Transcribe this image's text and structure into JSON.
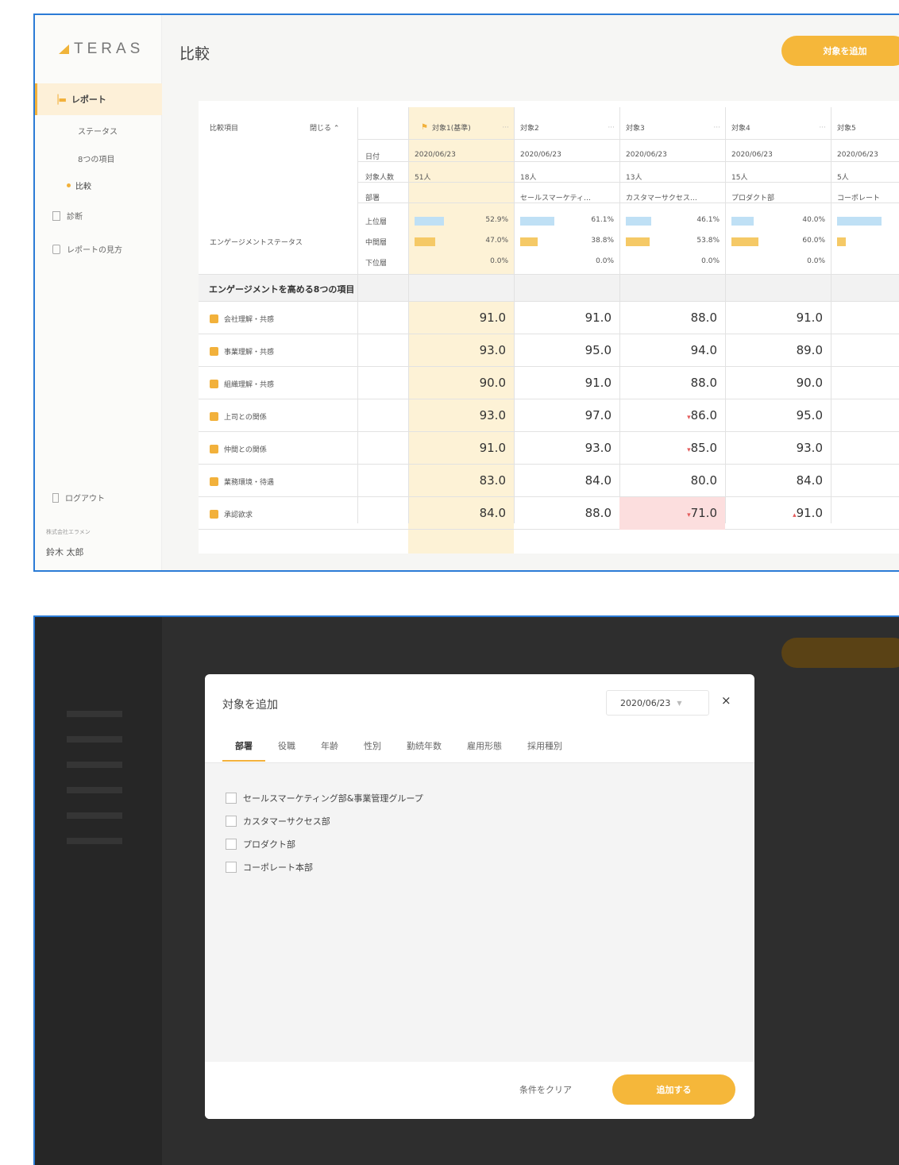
{
  "app": {
    "logo": "TERAS",
    "page_title": "比較",
    "add_target_label": "対象を追加"
  },
  "sidebar": {
    "report_label": "レポート",
    "sub_items": [
      "ステータス",
      "8つの項目",
      "比較"
    ],
    "diagnosis_label": "診断",
    "guide_label": "レポートの見方",
    "logout_label": "ログアウト",
    "company": "株式会社エラメン",
    "user": "鈴木 太郎"
  },
  "table": {
    "compare_label": "比較項目",
    "close_label": "閉じる",
    "meta_labels": [
      "日付",
      "対象人数",
      "部署"
    ],
    "targets": [
      {
        "name": "対象1(基準)",
        "date": "2020/06/23",
        "count": "51人",
        "dept": ""
      },
      {
        "name": "対象2",
        "date": "2020/06/23",
        "count": "18人",
        "dept": "セールスマーケティ…"
      },
      {
        "name": "対象3",
        "date": "2020/06/23",
        "count": "13人",
        "dept": "カスタマーサクセス…"
      },
      {
        "name": "対象4",
        "date": "2020/06/23",
        "count": "15人",
        "dept": "プロダクト部"
      },
      {
        "name": "対象5",
        "date": "2020/06/23",
        "count": "5人",
        "dept": "コーポレート"
      }
    ],
    "engagement_label": "エンゲージメントステータス",
    "level_labels": [
      "上位層",
      "中間層",
      "下位層"
    ],
    "levels": [
      [
        "52.9%",
        "47.0%",
        "0.0%"
      ],
      [
        "61.1%",
        "38.8%",
        "0.0%"
      ],
      [
        "46.1%",
        "53.8%",
        "0.0%"
      ],
      [
        "40.0%",
        "60.0%",
        "0.0%"
      ],
      [
        "",
        "",
        ""
      ]
    ],
    "level_fractions": [
      [
        0.529,
        0.47
      ],
      [
        0.611,
        0.388
      ],
      [
        0.461,
        0.538
      ],
      [
        0.4,
        0.6
      ],
      [
        0.8,
        0.2
      ]
    ],
    "section_title": "エンゲージメントを高める8つの項目",
    "items": [
      {
        "label": "会社理解・共感",
        "scores": [
          "91.0",
          "91.0",
          "88.0",
          "91.0"
        ]
      },
      {
        "label": "事業理解・共感",
        "scores": [
          "93.0",
          "95.0",
          "94.0",
          "89.0"
        ]
      },
      {
        "label": "組織理解・共感",
        "scores": [
          "90.0",
          "91.0",
          "88.0",
          "90.0"
        ]
      },
      {
        "label": "上司との関係",
        "scores": [
          "93.0",
          "97.0",
          "86.0",
          "95.0"
        ]
      },
      {
        "label": "仲間との関係",
        "scores": [
          "91.0",
          "93.0",
          "85.0",
          "93.0"
        ]
      },
      {
        "label": "業務環境・待遇",
        "scores": [
          "83.0",
          "84.0",
          "80.0",
          "84.0"
        ]
      },
      {
        "label": "承認欲求",
        "scores": [
          "84.0",
          "88.0",
          "71.0",
          "91.0"
        ]
      }
    ],
    "colors": {
      "top": "#bfe0f5",
      "mid": "#f5c966",
      "highlight": "#fdf2d6",
      "warn": "#fcdede"
    }
  },
  "modal": {
    "title": "対象を追加",
    "date": "2020/06/23",
    "close": "×",
    "tabs": [
      "部署",
      "役職",
      "年齢",
      "性別",
      "勤続年数",
      "雇用形態",
      "採用種別"
    ],
    "options": [
      "セールスマーケティング部&事業管理グループ",
      "カスタマーサクセス部",
      "プロダクト部",
      "コーポレート本部"
    ],
    "clear_label": "条件をクリア",
    "submit_label": "追加する"
  }
}
